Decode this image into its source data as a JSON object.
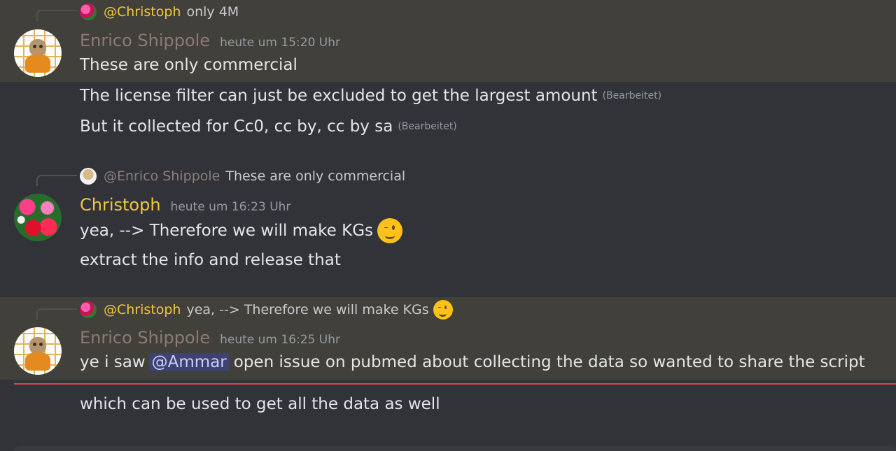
{
  "messages": [
    {
      "reply": {
        "author": "@Christoph",
        "text": "only 4M"
      },
      "author": "Enrico Shippole",
      "time": "heute um 15:20 Uhr",
      "lines": [
        {
          "text": "These are only commercial"
        }
      ]
    },
    {
      "lines": [
        {
          "text": "The license filter can just be excluded to get the largest amount",
          "edited": "(Bearbeitet)"
        },
        {
          "text": "But it collected for Cc0, cc by, cc by sa",
          "edited": "(Bearbeitet)"
        }
      ]
    },
    {
      "reply": {
        "author": "@Enrico Shippole",
        "text": "These are only commercial"
      },
      "author": "Christoph",
      "time": "heute um 16:23 Uhr",
      "lines": [
        {
          "text": "yea, --> Therefore we will make KGs",
          "emoji": "winking-face-emoji"
        },
        {
          "text": "extract the info and release that"
        }
      ]
    },
    {
      "reply": {
        "author": "@Christoph",
        "text": "yea, --> Therefore we will make KGs",
        "emoji": "winking-face-emoji"
      },
      "author": "Enrico Shippole",
      "time": "heute um 16:25 Uhr",
      "lines": [
        {
          "pre": "ye i saw",
          "mention": "@Ammar",
          "post": "open issue on pubmed about collecting the data so wanted to share the script"
        }
      ]
    },
    {
      "lines": [
        {
          "text": "which can be used to get all the data as well"
        }
      ]
    }
  ],
  "colors": {
    "background": "#313338",
    "highlight": "#42403a",
    "christoph_name": "#f0c73a",
    "enrico_name": "#8c7a73",
    "mention_bg": "#3d4270",
    "new_messages_line": "#e04149"
  }
}
